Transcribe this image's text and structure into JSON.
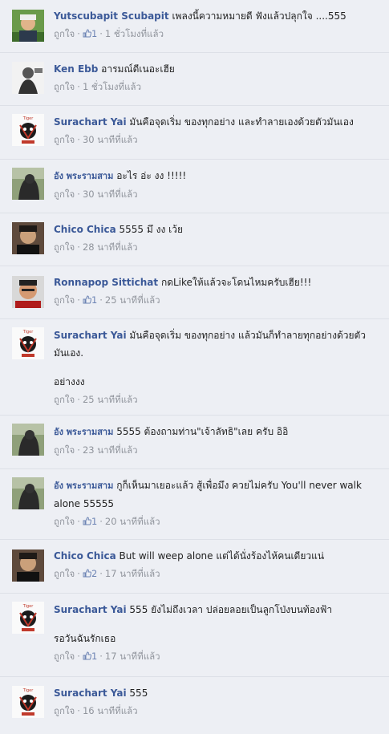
{
  "ui": {
    "like_label": "ถูกใจ",
    "sep": "·"
  },
  "comments": [
    {
      "author": "Yutscubapit Scubapit",
      "text": "เพลงนี้ความหมายดี ฟังแล้วปลุกใจ ....555",
      "likes": "1",
      "time": "1 ชั่วโมงที่แล้ว"
    },
    {
      "author": "Ken Ebb",
      "text": "อารมณ์ดีเนอะเฮีย",
      "time": "1 ชั่วโมงที่แล้ว"
    },
    {
      "author": "Surachart Yai",
      "text": "มันคือจุดเริ่ม ของทุกอย่าง และทำลายเองด้วยตัวมันเอง",
      "time": "30 นาทีที่แล้ว"
    },
    {
      "author": "อัง พระรามสาม",
      "text": "อะไร อ่ะ งง !!!!!",
      "time": "30 นาทีที่แล้ว"
    },
    {
      "author": "Chico Chica",
      "text": "5555 มึ งง เว้ย",
      "time": "28 นาทีที่แล้ว"
    },
    {
      "author": "Ronnapop Sittichat",
      "text": "กดLikeให้แล้วจะโดนไหมครับเฮีย!!!",
      "likes": "1",
      "time": "25 นาทีที่แล้ว"
    },
    {
      "author": "Surachart Yai",
      "text": "มันคือจุดเริ่ม ของทุกอย่าง แล้วมันก็ทำลายทุกอย่างด้วยตัวมันเอง.",
      "text2": "อย่างงง",
      "time": "25 นาทีที่แล้ว"
    },
    {
      "author": "อัง พระรามสาม",
      "text": "5555 ต้องถามท่าน\"เจ้าลัทธิ\"เลย ครับ อิอิ",
      "time": "23 นาทีที่แล้ว"
    },
    {
      "author": "อัง พระรามสาม",
      "text": "กูก็เห็นมาเยอะแล้ว สู้เพื่อมึง ควยไม่ครับ You'll never walk alone 55555",
      "likes": "1",
      "time": "20 นาทีที่แล้ว"
    },
    {
      "author": "Chico Chica",
      "text": "But will weep alone แต่ได้นั่งร้องไห้คนเดียวแน่",
      "likes": "2",
      "time": "17 นาทีที่แล้ว"
    },
    {
      "author": "Surachart Yai",
      "text": "555 ยังไม่ถึงเวลา ปล่อยลอยเป็นลูกโป่งบนท้องฟ้า",
      "text2": "รอวันฉันรักเธอ",
      "likes": "1",
      "time": "17 นาทีที่แล้ว"
    },
    {
      "author": "Surachart Yai",
      "text": "555",
      "time": "16 นาทีที่แล้ว"
    }
  ]
}
